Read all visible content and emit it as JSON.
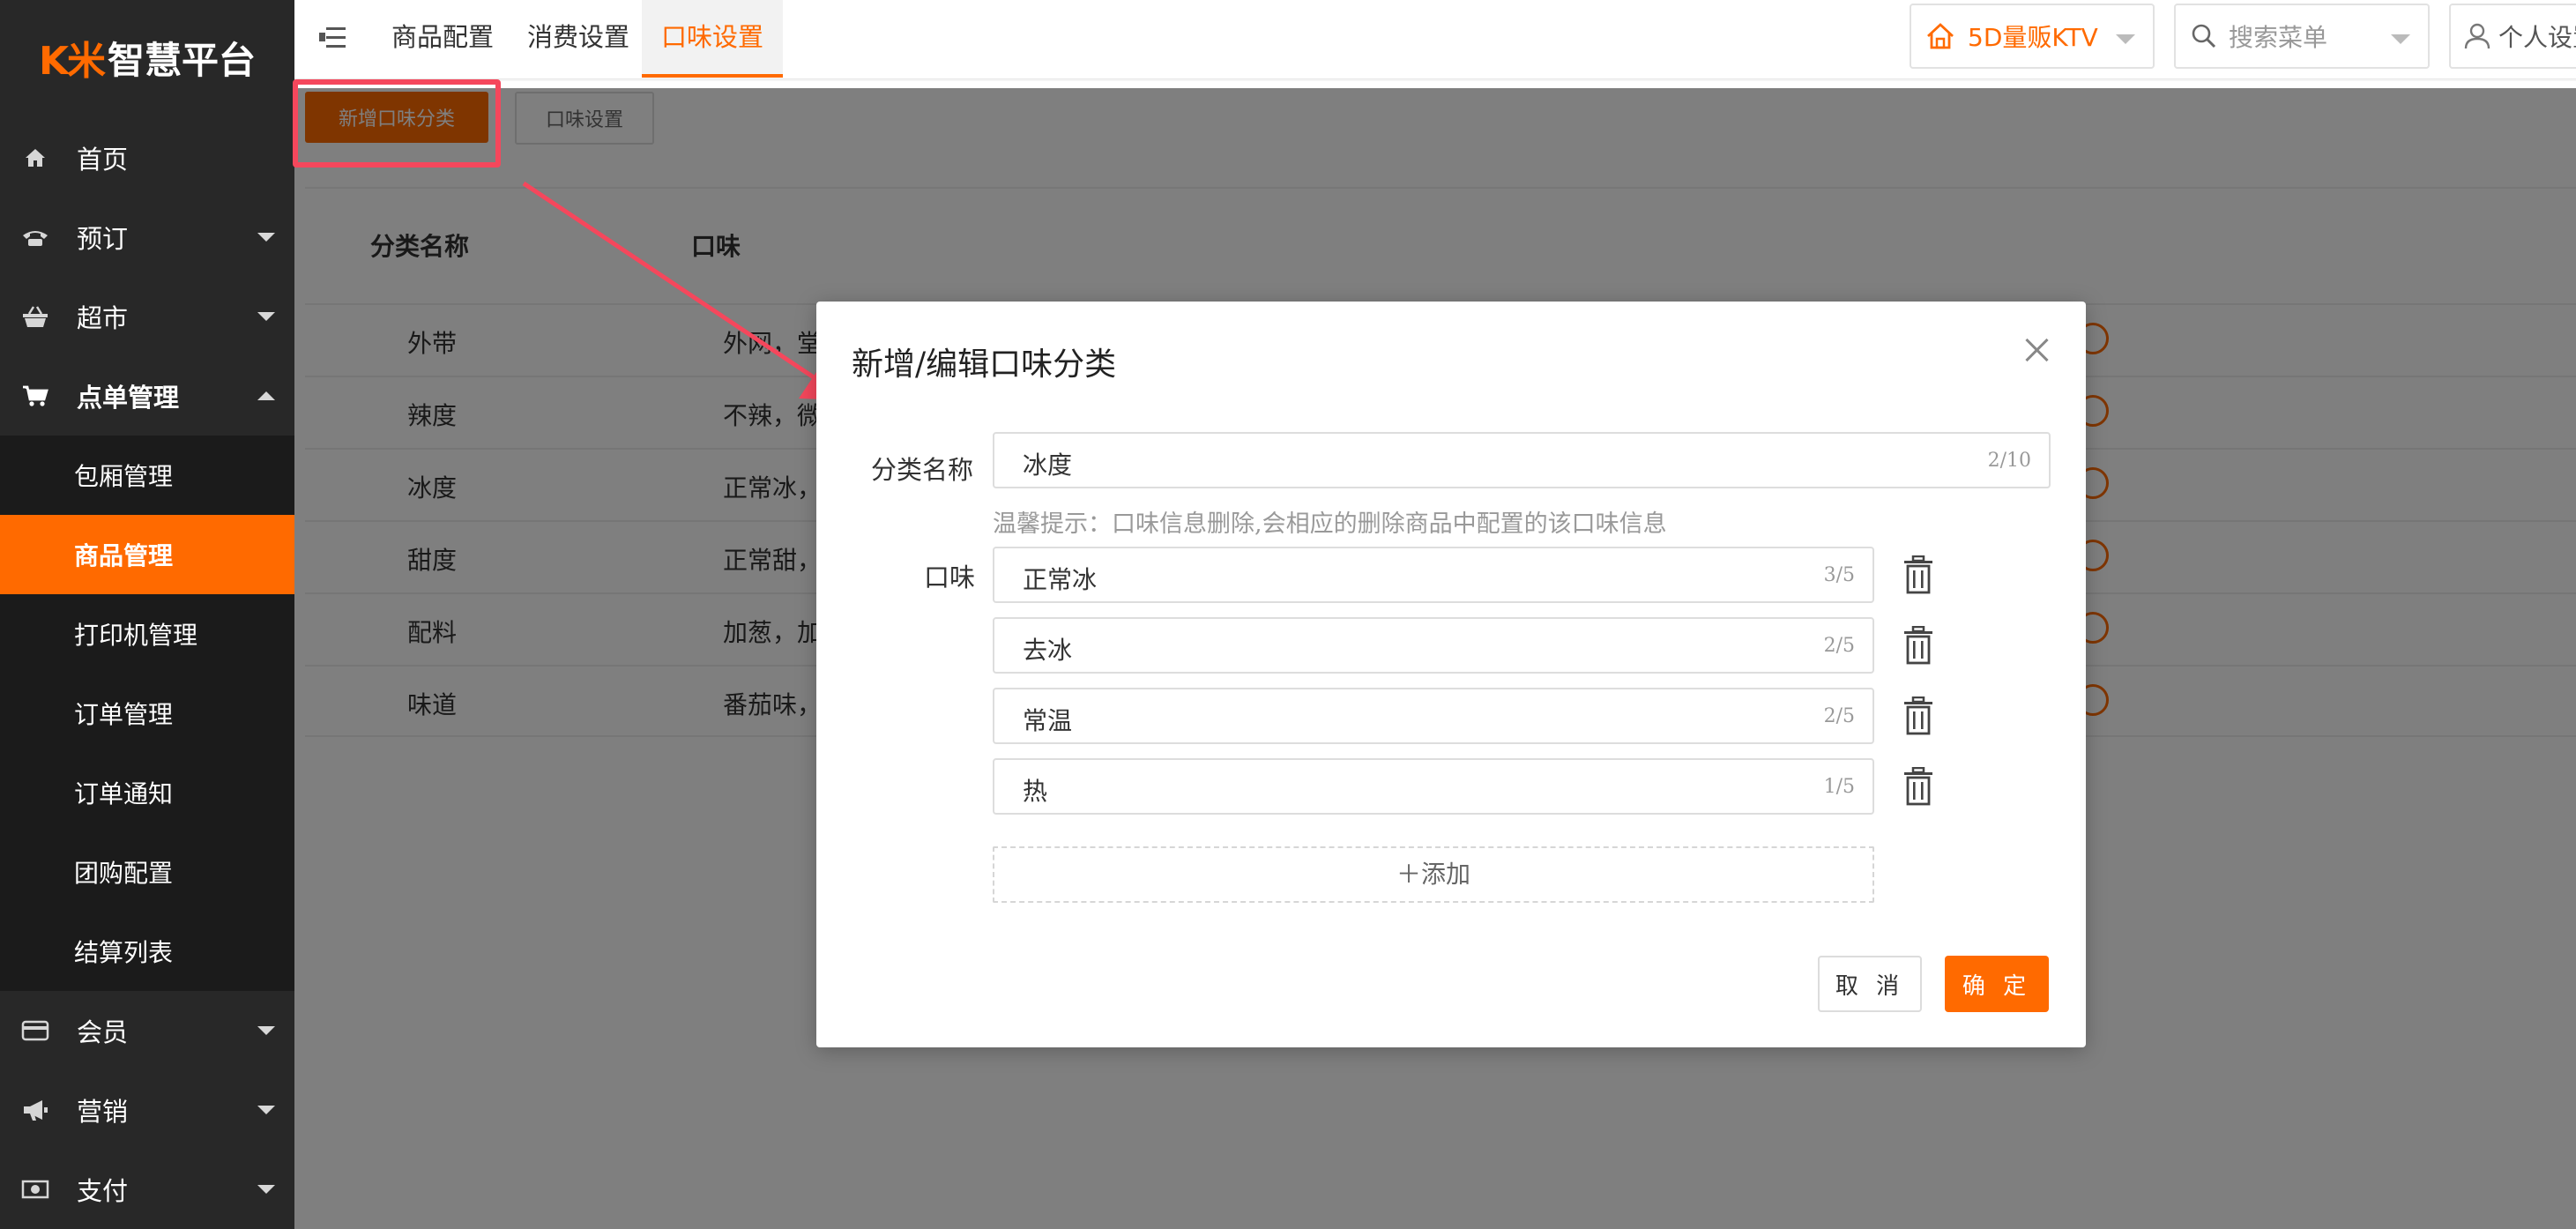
{
  "app": {
    "logo_mark": "K米",
    "logo_text": "智慧平台"
  },
  "sidebar": {
    "items": [
      {
        "label": "首页",
        "icon": "home-icon",
        "has_caret": false
      },
      {
        "label": "预订",
        "icon": "phone-icon",
        "has_caret": true
      },
      {
        "label": "超市",
        "icon": "basket-icon",
        "has_caret": true
      },
      {
        "label": "点单管理",
        "icon": "cart-icon",
        "has_caret": true,
        "expanded": true
      }
    ],
    "submenu": [
      {
        "label": "包厢管理"
      },
      {
        "label": "商品管理",
        "active": true
      },
      {
        "label": "打印机管理"
      },
      {
        "label": "订单管理"
      },
      {
        "label": "订单通知"
      },
      {
        "label": "团购配置"
      },
      {
        "label": "结算列表"
      }
    ],
    "items_after": [
      {
        "label": "会员",
        "icon": "card-icon"
      },
      {
        "label": "营销",
        "icon": "megaphone-icon"
      },
      {
        "label": "支付",
        "icon": "money-icon"
      }
    ]
  },
  "topbar": {
    "tabs": [
      {
        "label": "商品配置"
      },
      {
        "label": "消费设置"
      },
      {
        "label": "口味设置",
        "active": true
      }
    ],
    "store": "5D量贩KTV",
    "search_menu": "搜索菜单",
    "personal": "个人设置"
  },
  "toolbar": {
    "add_category": "新增口味分类",
    "flavor_settings": "口味设置"
  },
  "table": {
    "headers": {
      "name": "分类名称",
      "flavor": "口味"
    },
    "rows": [
      {
        "name": "外带",
        "flavor": "外网，堂"
      },
      {
        "name": "辣度",
        "flavor": "不辣，微"
      },
      {
        "name": "冰度",
        "flavor": "正常冰，"
      },
      {
        "name": "甜度",
        "flavor": "正常甜，"
      },
      {
        "name": "配料",
        "flavor": "加葱，加"
      },
      {
        "name": "味道",
        "flavor": "番茄味，"
      }
    ]
  },
  "modal": {
    "title": "新增/编辑口味分类",
    "category_label": "分类名称",
    "category_value": "冰度",
    "category_count": "2/10",
    "hint": "温馨提示：口味信息删除,会相应的删除商品中配置的该口味信息",
    "flavor_label": "口味",
    "flavors": [
      {
        "value": "正常冰",
        "count": "3/5"
      },
      {
        "value": "去冰",
        "count": "2/5"
      },
      {
        "value": "常温",
        "count": "2/5"
      },
      {
        "value": "热",
        "count": "1/5"
      }
    ],
    "add_label": "＋添加",
    "cancel": "取 消",
    "ok": "确 定"
  },
  "colors": {
    "accent": "#ff6a00",
    "sidebar_bg": "#282828",
    "submenu_bg": "#1b1b1b",
    "annotation_red": "#f5475c"
  }
}
